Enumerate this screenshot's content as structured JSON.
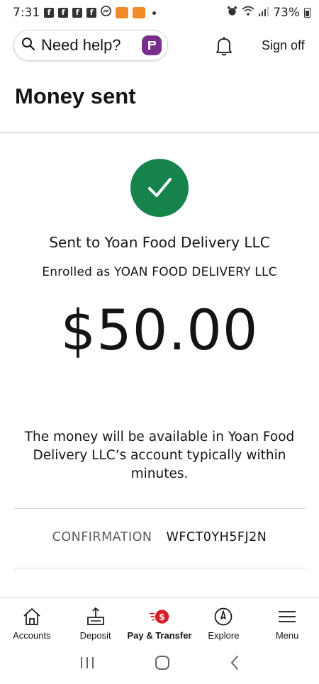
{
  "status_bar": {
    "time": "7:31",
    "battery": "73%"
  },
  "header": {
    "help_label": "Need help?",
    "sign_off_label": "Sign off"
  },
  "page_title": "Money sent",
  "confirmation": {
    "sent_to": "Sent to Yoan Food Delivery LLC",
    "enrolled_as": "Enrolled as YOAN FOOD DELIVERY LLC",
    "amount": "$50.00",
    "availability_note": "The money will be available in Yoan Food Delivery LLC’s account typically within minutes.",
    "confirmation_label": "CONFIRMATION",
    "confirmation_number": "WFCT0YH5FJ2N"
  },
  "bottom_nav": {
    "items": [
      {
        "label": "Accounts",
        "icon": "house-icon"
      },
      {
        "label": "Deposit",
        "icon": "deposit-icon"
      },
      {
        "label": "Pay & Transfer",
        "icon": "pay-transfer-icon",
        "active": true
      },
      {
        "label": "Explore",
        "icon": "compass-icon"
      },
      {
        "label": "Menu",
        "icon": "hamburger-icon"
      }
    ]
  },
  "colors": {
    "success_green": "#16834c",
    "fargo_purple": "#7b2d8e",
    "active_red": "#d71e28",
    "text_primary": "#141414",
    "text_secondary": "#5d5d5d"
  }
}
